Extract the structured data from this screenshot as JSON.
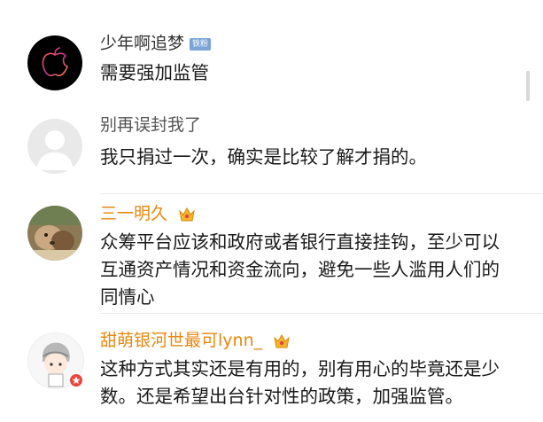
{
  "comments": [
    {
      "user": "少年啊追梦",
      "badge": "铁粉",
      "text": "需要强加监管",
      "name_color": "#333333"
    },
    {
      "user": "别再误封我了",
      "text": "我只捐过一次，确实是比较了解才捐的。",
      "name_color": "#555555"
    },
    {
      "user": "三一明久",
      "text": "众筹平台应该和政府或者银行直接挂钩，至少可以互通资产情况和资金流向，避免一些人滥用人们的同情心",
      "name_color": "#e8870f"
    },
    {
      "user": "甜萌银河世最可lynn_",
      "text": "这种方式其实还是有用的，别有用心的毕竟还是少数。还是希望出台针对性的政策，加强监管。",
      "name_color": "#e8870f"
    }
  ]
}
